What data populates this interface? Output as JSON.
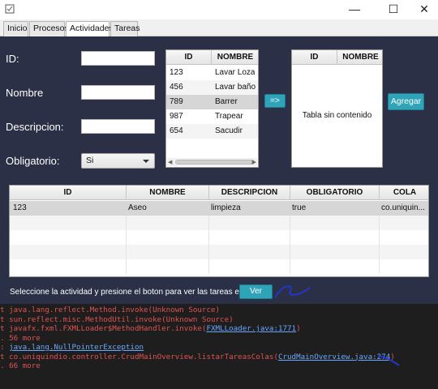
{
  "window": {
    "minimize_symbol": "—",
    "maximize_symbol": "☐",
    "close_symbol": "✕"
  },
  "tabs": [
    {
      "label": "Inicio",
      "active": false
    },
    {
      "label": "Procesos",
      "active": false
    },
    {
      "label": "Actividades",
      "active": true
    },
    {
      "label": "Tareas",
      "active": false
    }
  ],
  "form": {
    "id_label": "ID:",
    "nombre_label": "Nombre",
    "descripcion_label": "Descripcion:",
    "obligatorio_label": "Obligatorio:",
    "id_value": "",
    "nombre_value": "",
    "descripcion_value": "",
    "obligatorio_value": "Si"
  },
  "activities_table": {
    "headers": [
      "ID",
      "NOMBRE"
    ],
    "rows": [
      {
        "id": "123",
        "nombre": "Lavar Loza",
        "selected": false
      },
      {
        "id": "456",
        "nombre": "Lavar baño",
        "selected": false
      },
      {
        "id": "789",
        "nombre": "Barrer",
        "selected": true
      },
      {
        "id": "987",
        "nombre": "Trapear",
        "selected": false
      },
      {
        "id": "654",
        "nombre": "Sacudir",
        "selected": false
      }
    ]
  },
  "move_button_label": "=>",
  "queue_table": {
    "headers": [
      "ID",
      "NOMBRE"
    ],
    "empty_message": "Tabla sin contenido"
  },
  "add_button_label": "Agregar",
  "details_table": {
    "headers": [
      "ID",
      "NOMBRE",
      "DESCRIPCION",
      "OBLIGATORIO",
      "COLA"
    ],
    "rows": [
      [
        "123",
        "Aseo",
        "limpieza",
        "true",
        "co.uniquin..."
      ]
    ]
  },
  "footer": {
    "instruction": "Seleccione la actividad y presione el boton para ver las tareas en cola:",
    "ver_button_label": "Ver"
  },
  "console": {
    "lines": [
      {
        "text": "t java.lang.reflect.Method.invoke(Unknown Source)"
      },
      {
        "text": "t sun.reflect.misc.MethodUtil.invoke(Unknown Source)"
      },
      {
        "prefix": "t javafx.fxml.FXMLLoader$MethodHandler.invoke(",
        "link": "FXMLLoader.java:1771",
        "suffix": ")"
      },
      {
        "text": ". 56 more"
      },
      {
        "prefix": ": ",
        "link": "java.lang.NullPointerException",
        "suffix": ""
      },
      {
        "prefix": "t co.uniquindio.controller.CrudMainOverview.listarTareasColas(",
        "link": "CrudMainOverview.java:274",
        "suffix": ")"
      },
      {
        "text": ". 66 more"
      }
    ]
  }
}
